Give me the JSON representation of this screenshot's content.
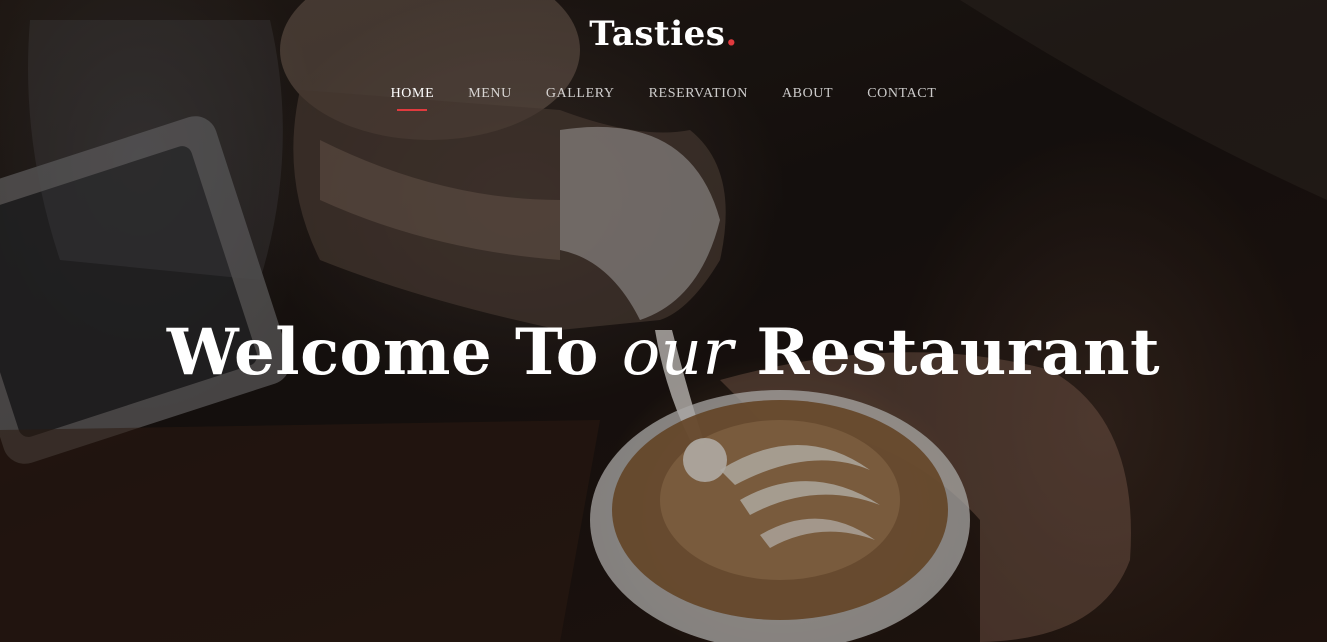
{
  "brand": {
    "name": "Tasties",
    "dot": ".",
    "accent_color": "#e03a3e"
  },
  "nav": {
    "items": [
      {
        "label": "HOME",
        "active": true
      },
      {
        "label": "MENU",
        "active": false
      },
      {
        "label": "GALLERY",
        "active": false
      },
      {
        "label": "RESERVATION",
        "active": false
      },
      {
        "label": "ABOUT",
        "active": false
      },
      {
        "label": "CONTACT",
        "active": false
      }
    ]
  },
  "hero": {
    "headline_part1": "Welcome To ",
    "headline_emphasis": "our",
    "headline_part2": " Restaurant",
    "background_image": "latte-art-pour-photo"
  }
}
